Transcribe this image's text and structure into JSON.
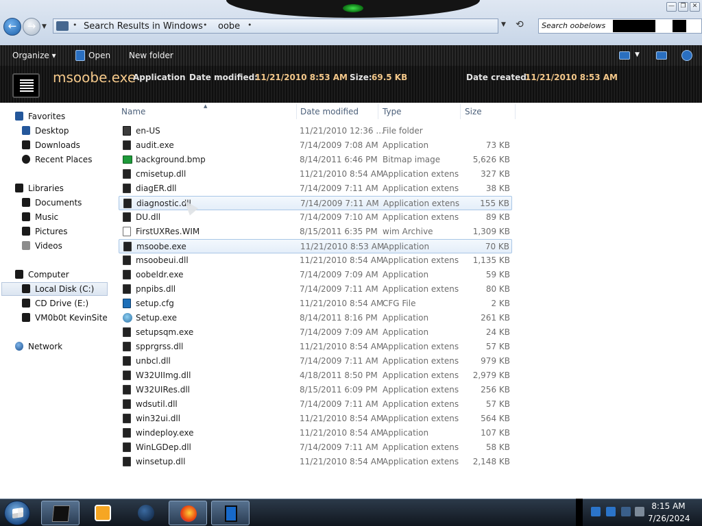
{
  "window": {
    "controls": [
      "—",
      "❐",
      "✕"
    ]
  },
  "address_bar": {
    "crumbs": [
      "Search Results in Windows",
      "oobe"
    ],
    "separator": "•"
  },
  "search": {
    "placeholder": "Search oobelows"
  },
  "toolbar": {
    "organize_label": "Organize ▾",
    "open_label": "Open",
    "new_folder_label": "New folder"
  },
  "details": {
    "file_name": "msoobe.exe",
    "file_type": "Application",
    "date_modified_label": "Date modified:",
    "date_modified_value": "11/21/2010 8:53 AM",
    "size_label": "Size:",
    "size_value": "69.5 KB",
    "date_created_label": "Date created:",
    "date_created_value": "11/21/2010 8:53 AM"
  },
  "nav": {
    "favorites": "Favorites",
    "desktop": "Desktop",
    "downloads": "Downloads",
    "recent_places": "Recent Places",
    "libraries": "Libraries",
    "documents": "Documents",
    "music": "Music",
    "pictures": "Pictures",
    "videos": "Videos",
    "computer": "Computer",
    "local_disk": "Local Disk (C:)",
    "cd_drive": "CD Drive (E:)",
    "vm_site": "VM0b0t KevinSite",
    "network": "Network"
  },
  "columns": {
    "name": "Name",
    "date_modified": "Date modified",
    "type": "Type",
    "size": "Size"
  },
  "files": [
    {
      "name": "en-US",
      "date": "11/21/2010 12:36 ...",
      "type": "File folder",
      "size": "",
      "icon": "folder"
    },
    {
      "name": "audit.exe",
      "date": "7/14/2009 7:08 AM",
      "type": "Application",
      "size": "73 KB",
      "icon": "exe"
    },
    {
      "name": "background.bmp",
      "date": "8/14/2011 6:46 PM",
      "type": "Bitmap image",
      "size": "5,626 KB",
      "icon": "img"
    },
    {
      "name": "cmisetup.dll",
      "date": "11/21/2010 8:54 AM",
      "type": "Application extens...",
      "size": "327 KB",
      "icon": "dll"
    },
    {
      "name": "diagER.dll",
      "date": "7/14/2009 7:11 AM",
      "type": "Application extens...",
      "size": "38 KB",
      "icon": "dll"
    },
    {
      "name": "diagnostic.dll",
      "date": "7/14/2009 7:11 AM",
      "type": "Application extens...",
      "size": "155 KB",
      "icon": "dll",
      "state": "hover"
    },
    {
      "name": "DU.dll",
      "date": "7/14/2009 7:10 AM",
      "type": "Application extens...",
      "size": "89 KB",
      "icon": "dll"
    },
    {
      "name": "FirstUXRes.WIM",
      "date": "8/15/2011 6:35 PM",
      "type": "wim Archive",
      "size": "1,309 KB",
      "icon": "wim"
    },
    {
      "name": "msoobe.exe",
      "date": "11/21/2010 8:53 AM",
      "type": "Application",
      "size": "70 KB",
      "icon": "exe",
      "state": "selected"
    },
    {
      "name": "msoobeui.dll",
      "date": "11/21/2010 8:54 AM",
      "type": "Application extens...",
      "size": "1,135 KB",
      "icon": "dll"
    },
    {
      "name": "oobeldr.exe",
      "date": "7/14/2009 7:09 AM",
      "type": "Application",
      "size": "59 KB",
      "icon": "exe"
    },
    {
      "name": "pnpibs.dll",
      "date": "7/14/2009 7:11 AM",
      "type": "Application extens...",
      "size": "80 KB",
      "icon": "dll"
    },
    {
      "name": "setup.cfg",
      "date": "11/21/2010 8:54 AM",
      "type": "CFG File",
      "size": "2 KB",
      "icon": "cfg"
    },
    {
      "name": "Setup.exe",
      "date": "8/14/2011 8:16 PM",
      "type": "Application",
      "size": "261 KB",
      "icon": "setup"
    },
    {
      "name": "setupsqm.exe",
      "date": "7/14/2009 7:09 AM",
      "type": "Application",
      "size": "24 KB",
      "icon": "exe"
    },
    {
      "name": "spprgrss.dll",
      "date": "11/21/2010 8:54 AM",
      "type": "Application extens...",
      "size": "57 KB",
      "icon": "dll"
    },
    {
      "name": "unbcl.dll",
      "date": "7/14/2009 7:11 AM",
      "type": "Application extens...",
      "size": "979 KB",
      "icon": "dll"
    },
    {
      "name": "W32UIImg.dll",
      "date": "4/18/2011 8:50 PM",
      "type": "Application extens...",
      "size": "2,979 KB",
      "icon": "dll"
    },
    {
      "name": "W32UIRes.dll",
      "date": "8/15/2011 6:09 PM",
      "type": "Application extens...",
      "size": "256 KB",
      "icon": "dll"
    },
    {
      "name": "wdsutil.dll",
      "date": "7/14/2009 7:11 AM",
      "type": "Application extens...",
      "size": "57 KB",
      "icon": "dll"
    },
    {
      "name": "win32ui.dll",
      "date": "11/21/2010 8:54 AM",
      "type": "Application extens...",
      "size": "564 KB",
      "icon": "dll"
    },
    {
      "name": "windeploy.exe",
      "date": "11/21/2010 8:54 AM",
      "type": "Application",
      "size": "107 KB",
      "icon": "exe"
    },
    {
      "name": "WinLGDep.dll",
      "date": "7/14/2009 7:11 AM",
      "type": "Application extens...",
      "size": "58 KB",
      "icon": "dll"
    },
    {
      "name": "winsetup.dll",
      "date": "11/21/2010 8:54 AM",
      "type": "Application extens...",
      "size": "2,148 KB",
      "icon": "dll"
    }
  ],
  "taskbar": {
    "items": [
      "folder-app-icon",
      "media-player-icon",
      "globe-icon",
      "firefox-icon",
      "device-app-icon"
    ]
  },
  "clock": {
    "time": "8:15 AM",
    "date": "7/26/2024"
  }
}
